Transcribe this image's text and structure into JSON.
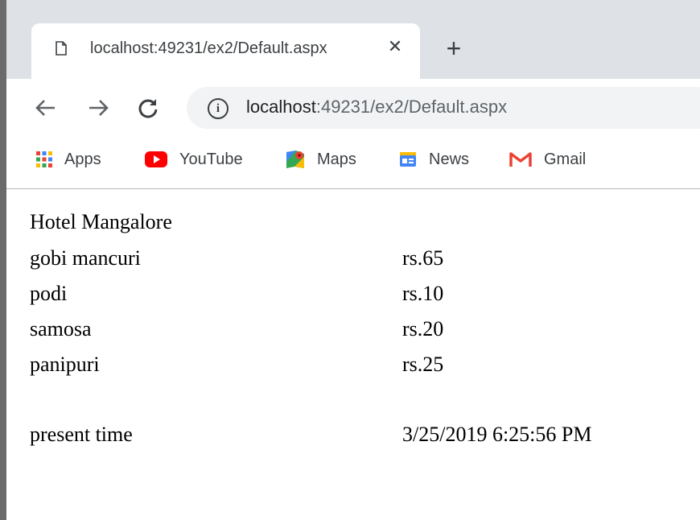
{
  "browser": {
    "tab": {
      "title": "localhost:49231/ex2/Default.aspx"
    },
    "address_bar": {
      "host": "localhost",
      "rest": ":49231/ex2/Default.aspx"
    },
    "bookmarks": [
      {
        "label": "Apps",
        "icon": "apps-grid-icon"
      },
      {
        "label": "YouTube",
        "icon": "youtube-icon"
      },
      {
        "label": "Maps",
        "icon": "maps-icon"
      },
      {
        "label": "News",
        "icon": "news-icon"
      },
      {
        "label": "Gmail",
        "icon": "gmail-icon"
      }
    ]
  },
  "page": {
    "title": "Hotel Mangalore",
    "menu": [
      {
        "name": "gobi mancuri",
        "price": "rs.65"
      },
      {
        "name": "podi",
        "price": "rs.10"
      },
      {
        "name": "samosa",
        "price": "rs.20"
      },
      {
        "name": "panipuri",
        "price": "rs.25"
      }
    ],
    "time": {
      "label": "present time",
      "value": "3/25/2019 6:25:56 PM"
    }
  }
}
